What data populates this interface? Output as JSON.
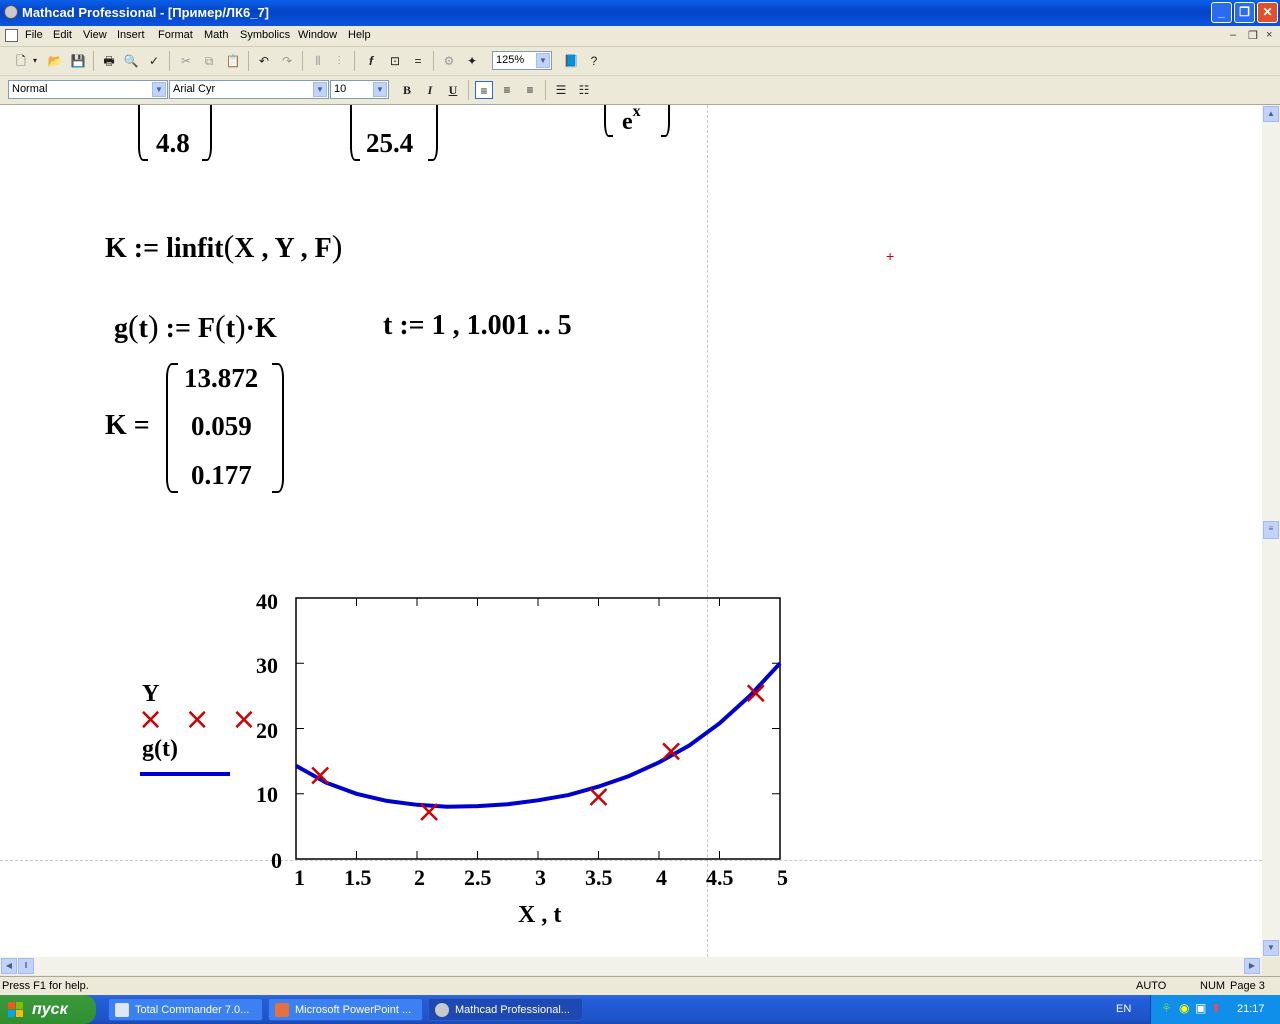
{
  "window": {
    "title": "Mathcad Professional - [Пример/ЛК6_7]",
    "min": "_",
    "max": "❐",
    "close": "✕"
  },
  "menu": [
    "File",
    "Edit",
    "View",
    "Insert",
    "Format",
    "Math",
    "Symbolics",
    "Window",
    "Help"
  ],
  "toolbar": {
    "zoom": "125%",
    "style": "Normal",
    "font": "Arial Cyr",
    "size": "10",
    "bold": "B",
    "italic": "I",
    "underline": "U"
  },
  "worksheet": {
    "top_vec1_last": "4.8",
    "top_vec2_last": "25.4",
    "top_func_last": "e",
    "top_func_exp": "x",
    "linfit_expr": {
      "lhs": "K",
      "assign": ":=",
      "fn": "linfit",
      "args": "X , Y , F"
    },
    "g_def": {
      "lhs": "g",
      "arg": "t",
      "assign": ":=",
      "rhs_fn": "F",
      "rhs_arg": "t",
      "dot": "·",
      "rhs_k": "K"
    },
    "t_range": {
      "lhs": "t",
      "assign": ":=",
      "rhs": "1 , 1.001 .. 5"
    },
    "k_result": {
      "lhs": "K",
      "eq": "=",
      "values": [
        "13.872",
        "0.059",
        "0.177"
      ]
    }
  },
  "chart_data": {
    "type": "scatter",
    "xlabel": "X , t",
    "legend": [
      {
        "name": "Y",
        "marker": "× × ×",
        "color": "#d00000"
      },
      {
        "name": "g(t)",
        "color": "#0000cc"
      }
    ],
    "xlim": [
      1,
      5
    ],
    "ylim": [
      0,
      40
    ],
    "xticks": [
      "1",
      "1.5",
      "2",
      "2.5",
      "3",
      "3.5",
      "4",
      "4.5",
      "5"
    ],
    "yticks": [
      "0",
      "10",
      "20",
      "30",
      "40"
    ],
    "series": [
      {
        "name": "Y",
        "style": "markers",
        "color": "#d00000",
        "x": [
          1.2,
          2.1,
          3.5,
          4.1,
          4.8
        ],
        "y": [
          12.8,
          7.2,
          9.5,
          16.5,
          25.4
        ]
      },
      {
        "name": "g(t)",
        "style": "line",
        "color": "#0000cc",
        "x": [
          1,
          1.25,
          1.5,
          1.75,
          2,
          2.25,
          2.5,
          2.75,
          3,
          3.25,
          3.5,
          3.75,
          4,
          4.25,
          4.5,
          4.75,
          5
        ],
        "y": [
          14.3,
          11.7,
          10.0,
          8.9,
          8.3,
          8.0,
          8.1,
          8.4,
          9.0,
          9.8,
          11.1,
          12.7,
          14.8,
          17.4,
          20.8,
          25.0,
          30.0
        ]
      }
    ]
  },
  "status": {
    "help": "Press F1 for help.",
    "mode": "AUTO",
    "num": "NUM",
    "page": "Page 3"
  },
  "taskbar": {
    "start": "пуск",
    "tasks": [
      "Total Commander 7.0...",
      "Microsoft PowerPoint ...",
      "Mathcad Professional..."
    ],
    "lang": "EN",
    "clock": "21:17"
  }
}
